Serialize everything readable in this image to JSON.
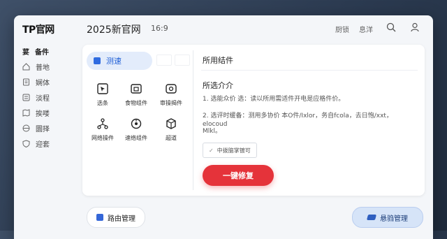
{
  "header": {
    "logo_tp": "TP",
    "logo_text": "官网",
    "title": "2025新官网",
    "ratio": "16:9",
    "links": [
      "厨锁",
      "息洋"
    ]
  },
  "sidebar": {
    "items": [
      {
        "label": "备件",
        "icon": "category-icon"
      },
      {
        "label": "普地",
        "icon": "home-icon"
      },
      {
        "label": "娴体",
        "icon": "document-icon"
      },
      {
        "label": "淡程",
        "icon": "list-icon"
      },
      {
        "label": "挨喽",
        "icon": "map-icon"
      },
      {
        "label": "圜择",
        "icon": "globe-icon"
      },
      {
        "label": "迎套",
        "icon": "shield-icon"
      }
    ],
    "active_prefix": "荽"
  },
  "tools": {
    "speed_label": "测速",
    "items": [
      {
        "label": "选条",
        "icon": "select-icon"
      },
      {
        "label": "食物组件",
        "icon": "box-icon"
      },
      {
        "label": "审操揭件",
        "icon": "gear-icon"
      },
      {
        "label": "网络操件",
        "icon": "network-icon"
      },
      {
        "label": "速络组件",
        "icon": "nodes-icon"
      },
      {
        "label": "超道",
        "icon": "cube-icon"
      }
    ]
  },
  "panel": {
    "title": "所用结件",
    "subtitle": "所选介介",
    "line1": "1. 选能众价 选：读以所用需适件开电是应格件价。",
    "line2": "2. 选评时缓备：测用多协价 本O件/Ixlor，务自fcola，去日怉/xxt，elocoud",
    "line3": "Mlkl。",
    "chip": "中拨脑掌镀可",
    "repair": "一键修复"
  },
  "bottom": {
    "route": "路由管理",
    "hang": "悬驺管理"
  },
  "colors": {
    "accent_blue": "#2f6be0",
    "repair_red": "#e5333a",
    "logo_red": "#e03232"
  }
}
